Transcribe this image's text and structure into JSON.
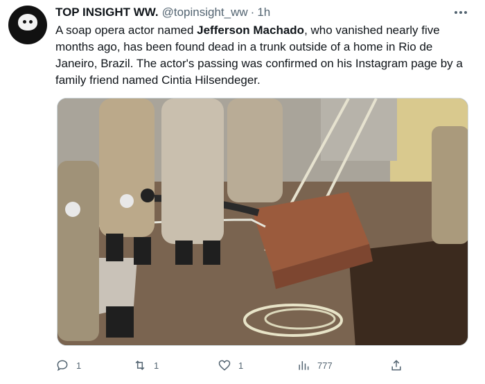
{
  "tweet": {
    "display_name": "TOP INSIGHT WW.",
    "handle": "@topinsight_ww",
    "separator": "·",
    "time": "1h",
    "text_before": "A soap opera actor named ",
    "text_bold": "Jefferson Machado",
    "text_after": ", who vanished nearly five months ago, has been found dead in a trunk outside of a home in Rio de Janeiro, Brazil. The actor's passing was confirmed on his Instagram page by a family friend named Cintia Hilsendeger."
  },
  "actions": {
    "reply_count": "1",
    "retweet_count": "1",
    "like_count": "1",
    "views_count": "777"
  },
  "icons": {
    "avatar": "top-insight-logo",
    "more": "more-icon",
    "reply": "reply-icon",
    "retweet": "retweet-icon",
    "like": "like-icon",
    "views": "views-icon",
    "share": "share-icon"
  },
  "colors": {
    "text": "#0f1419",
    "secondary": "#536471",
    "border": "#cfd9de"
  }
}
